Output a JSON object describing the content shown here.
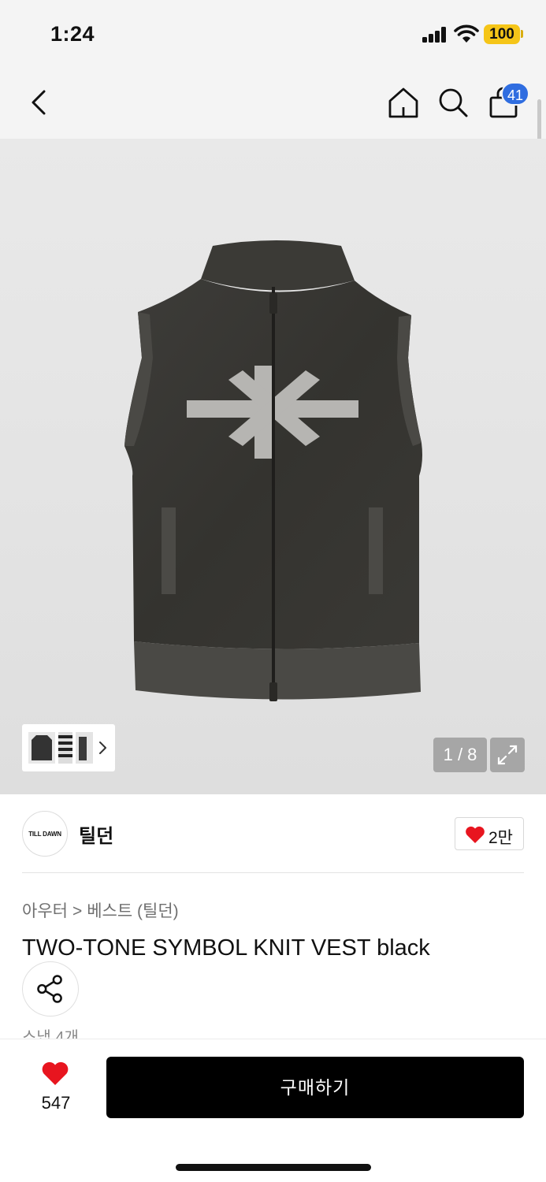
{
  "status_bar": {
    "time": "1:24",
    "battery": "100",
    "battery_color": "#f5c518"
  },
  "nav": {
    "back_icon": "chevron-left-icon",
    "home_icon": "home-icon",
    "search_icon": "search-icon",
    "cart_icon": "shopping-bag-icon",
    "cart_badge": "41",
    "badge_color": "#2f6de0"
  },
  "gallery": {
    "counter": "1 / 8",
    "fullscreen_icon": "expand-icon",
    "thumbnail_arrow_icon": "chevron-right-icon"
  },
  "brand": {
    "logo_text": "TILL DAWN",
    "name": "틸던",
    "likes": "2만",
    "heart_color": "#e8151f"
  },
  "breadcrumb": {
    "category": "아우터",
    "separator": ">",
    "subcategory": "베스트 (틸던)"
  },
  "product": {
    "title": "TWO-TONE SYMBOL KNIT VEST black",
    "share_icon": "share-icon",
    "snap": "스냅 4개"
  },
  "bottom_bar": {
    "wish_count": "547",
    "buy_label": "구매하기"
  }
}
